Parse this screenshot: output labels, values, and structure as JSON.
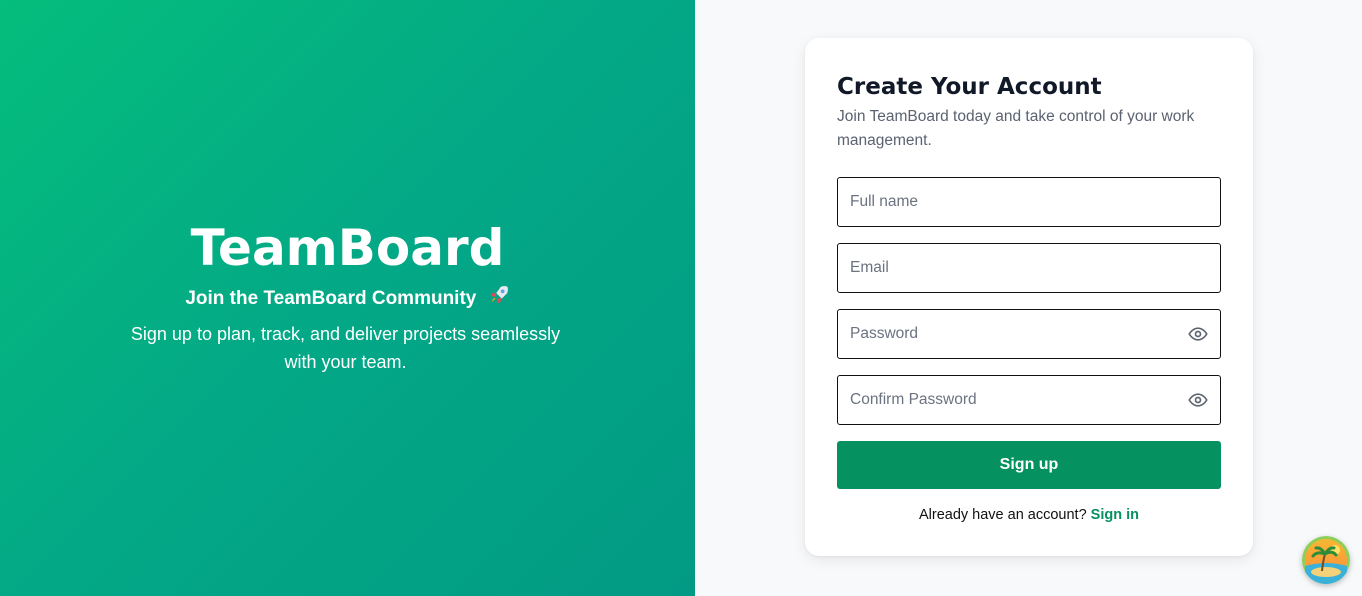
{
  "hero": {
    "title": "TeamBoard",
    "subtitle": "Join the TeamBoard Community",
    "subtitle_icon": "rocket-icon",
    "description": "Sign up to plan, track, and deliver projects seamlessly with your team."
  },
  "card": {
    "title": "Create Your Account",
    "description": "Join TeamBoard today and take control of your work management."
  },
  "form": {
    "full_name": {
      "value": "",
      "placeholder": "Full name"
    },
    "email": {
      "value": "",
      "placeholder": "Email"
    },
    "password": {
      "value": "",
      "placeholder": "Password",
      "toggle_icon": "eye-icon"
    },
    "confirm_password": {
      "value": "",
      "placeholder": "Confirm Password",
      "toggle_icon": "eye-icon"
    },
    "submit_label": "Sign up"
  },
  "signin": {
    "prompt": "Already have an account?",
    "link_label": "Sign in"
  },
  "floating_badge": {
    "icon": "beach-avatar-icon"
  },
  "colors": {
    "hero_gradient_start": "#05bd7c",
    "hero_gradient_end": "#029a84",
    "accent": "#059160",
    "page_background": "#f8f9fb"
  }
}
